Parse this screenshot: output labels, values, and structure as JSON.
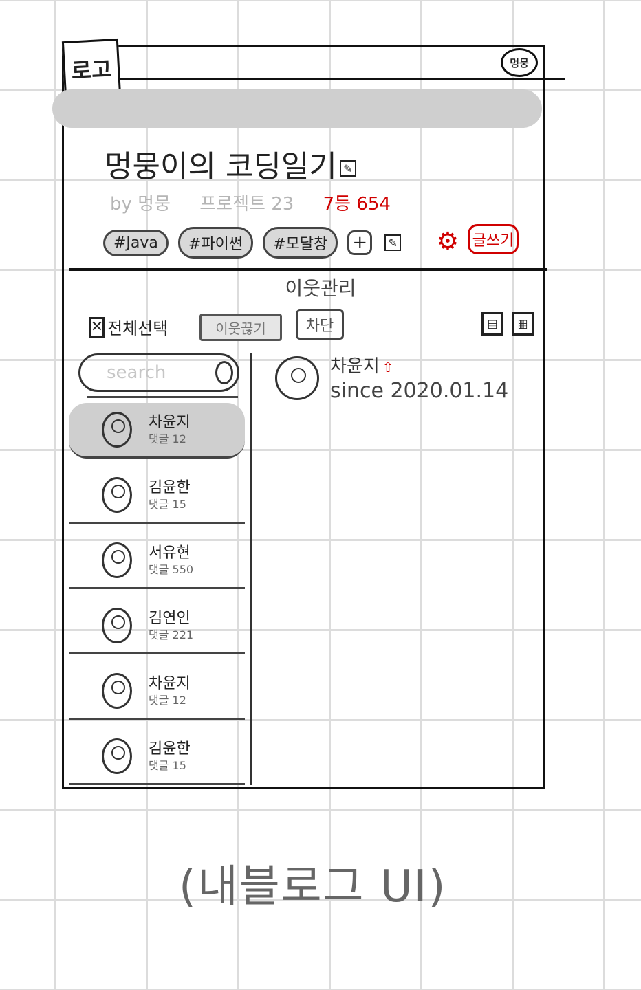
{
  "header": {
    "logo": "로고",
    "profile": "멍뭉"
  },
  "blog": {
    "title": "멍뭉이의 코딩일기",
    "author": "by 멍뭉",
    "projects": "프로젝트 23",
    "visitors": "7등 654",
    "tags": [
      "#Java",
      "#파이썬",
      "#모달창"
    ],
    "add_tag": "+",
    "write_button": "글쓰기"
  },
  "section": {
    "title": "이웃관리"
  },
  "toolbar": {
    "select_all": "전체선택",
    "neighbor_button": "이웃끊기",
    "block_button": "차단"
  },
  "search": {
    "placeholder": "search"
  },
  "neighbors": [
    {
      "name": "차윤지",
      "comments": "댓글 12",
      "selected": true
    },
    {
      "name": "김윤한",
      "comments": "댓글 15",
      "selected": false
    },
    {
      "name": "서유현",
      "comments": "댓글 550",
      "selected": false
    },
    {
      "name": "김연인",
      "comments": "댓글 221",
      "selected": false
    },
    {
      "name": "차윤지",
      "comments": "댓글 12",
      "selected": false
    },
    {
      "name": "김윤한",
      "comments": "댓글 15",
      "selected": false
    }
  ],
  "detail": {
    "name": "차윤지",
    "since": "since 2020.01.14"
  },
  "footer": {
    "note": "(내블로그 UI)"
  },
  "colors": {
    "accent": "#d00000",
    "selected_bg": "#cfcfcf",
    "grid": "#dcdcdc"
  }
}
